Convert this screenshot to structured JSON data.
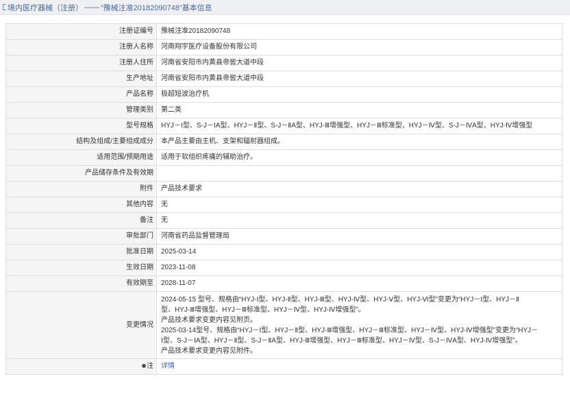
{
  "breadcrumb": {
    "section": "境内医疗器械（注册）",
    "separator": "——",
    "title": "“豫械注准20182090748”基本信息"
  },
  "rows": [
    {
      "label": "注册证编号",
      "value": "豫械注准20182090748"
    },
    {
      "label": "注册人名称",
      "value": "河南翔宇医疗设备股份有限公司"
    },
    {
      "label": "注册人住所",
      "value": "河南省安阳市内黄县帝喾大道中段"
    },
    {
      "label": "生产地址",
      "value": "河南省安阳市内黄县帝喾大道中段"
    },
    {
      "label": "产品名称",
      "value": "极超短波治疗机"
    },
    {
      "label": "管理类别",
      "value": "第二类"
    },
    {
      "label": "型号规格",
      "value": "HYJ－Ⅰ型、S-J－ⅠA型、HYJ－Ⅱ型、S-J－ⅡA型、HYJ-Ⅲ增强型、HYJ－Ⅲ标准型、HYJ－Ⅳ型、S-J－ⅣA型、HYJ-Ⅳ增强型"
    },
    {
      "label": "结构及组成/主要组成成分",
      "value": "本产品主要由主机、支架和辐射器组成。"
    },
    {
      "label": "适用范围/预期用途",
      "value": "适用于软组织疼痛的辅助治疗。"
    },
    {
      "label": "产品储存条件及有效期",
      "value": ""
    },
    {
      "label": "附件",
      "value": "产品技术要求"
    },
    {
      "label": "其他内容",
      "value": "无"
    },
    {
      "label": "备注",
      "value": "无"
    },
    {
      "label": "审批部门",
      "value": "河南省药品监督管理局"
    },
    {
      "label": "批准日期",
      "value": "2025-03-14"
    },
    {
      "label": "生效日期",
      "value": "2023-11-08"
    },
    {
      "label": "有效期至",
      "value": "2028-11-07"
    }
  ],
  "changes": {
    "label": "变更情况",
    "lines": [
      "2024-05-15 型号、规格由“HYJ-Ⅰ型、HYJ-Ⅱ型、HYJ-Ⅲ型、HYJ-Ⅳ型、HYJ-Ⅴ型、HYJ-Ⅵ型”变更为“HYJ－Ⅰ型、HYJ－Ⅱ",
      "型、HYJ-Ⅲ增强型、HYJ－Ⅲ标准型、HYJ－Ⅳ型、HYJ-Ⅳ增强型”。",
      "产品技术要求变更内容见附页。",
      "2025-03-14型号、规格由“HYJ－Ⅰ型、HYJ－Ⅱ型、HYJ-Ⅲ增强型、HYJ－Ⅲ标准型、HYJ－Ⅳ型、HYJ-Ⅳ增强型”变更为“HYJ－",
      "Ⅰ型、S-J－ⅠA型、HYJ－Ⅱ型、S-J－ⅡA型、HYJ-Ⅲ增强型、HYJ－Ⅲ标准型、HYJ－Ⅳ型、S-J－ⅣA型、HYJ-Ⅳ增强型”。",
      "产品技术要求变更内容见附件。"
    ]
  },
  "note": {
    "label": "注",
    "link": "详情",
    "icon": "info-dot-icon"
  }
}
